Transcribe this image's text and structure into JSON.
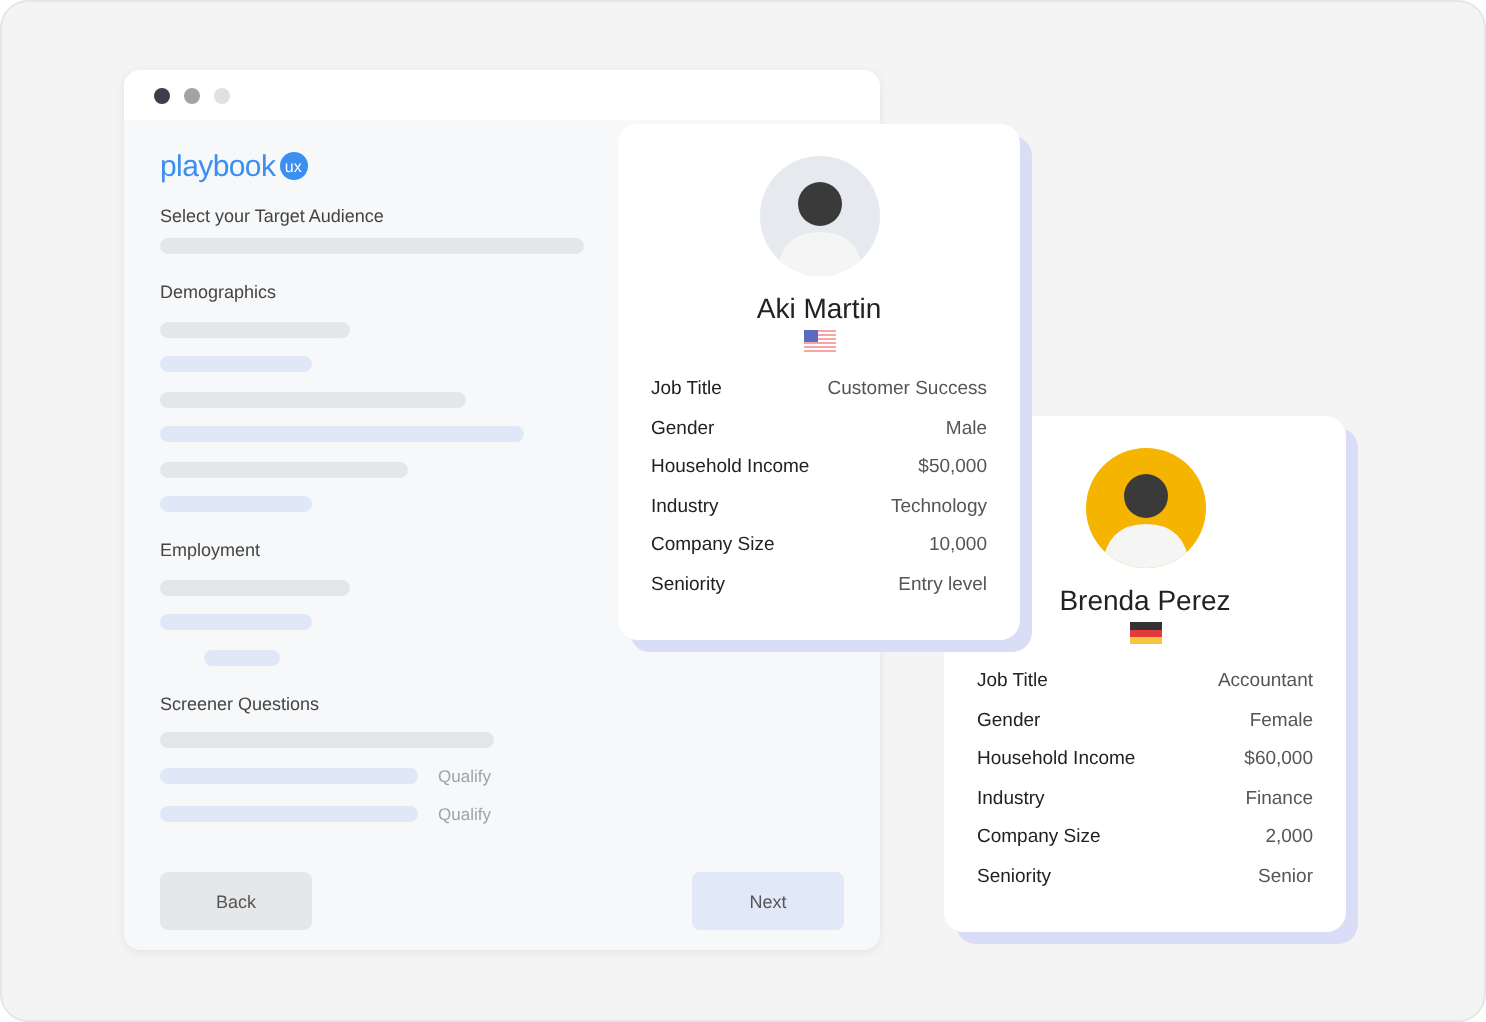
{
  "app": {
    "logo": "playbook",
    "logo_badge": "ux"
  },
  "form": {
    "title": "Select your Target Audience",
    "sections": [
      {
        "title": "Demographics"
      },
      {
        "title": "Employment"
      },
      {
        "title": "Screener Questions"
      }
    ],
    "qualify_labels": [
      "Qualify",
      "Qualify"
    ],
    "buttons": [
      {
        "label": "Back",
        "kind": "secondary"
      },
      {
        "label": "Next",
        "kind": "primary"
      }
    ]
  },
  "profiles": [
    {
      "name": "Aki Martin",
      "fields": [
        {
          "label": "Job Title",
          "value": "Customer Success"
        },
        {
          "label": "Gender",
          "value": "Male"
        },
        {
          "label": "Household Income",
          "value": "$50,000"
        },
        {
          "label": "Industry",
          "value": "Technology"
        },
        {
          "label": "Company Size",
          "value": "10,000"
        },
        {
          "label": "Seniority",
          "value": "Entry level"
        }
      ]
    },
    {
      "name": "Brenda Perez",
      "fields": [
        {
          "label": "Job Title",
          "value": "Accountant"
        },
        {
          "label": "Gender",
          "value": "Female"
        },
        {
          "label": "Household Income",
          "value": "$60,000"
        },
        {
          "label": "Industry",
          "value": "Finance"
        },
        {
          "label": "Company Size",
          "value": "2,000"
        },
        {
          "label": "Seniority",
          "value": "Senior"
        }
      ]
    }
  ]
}
